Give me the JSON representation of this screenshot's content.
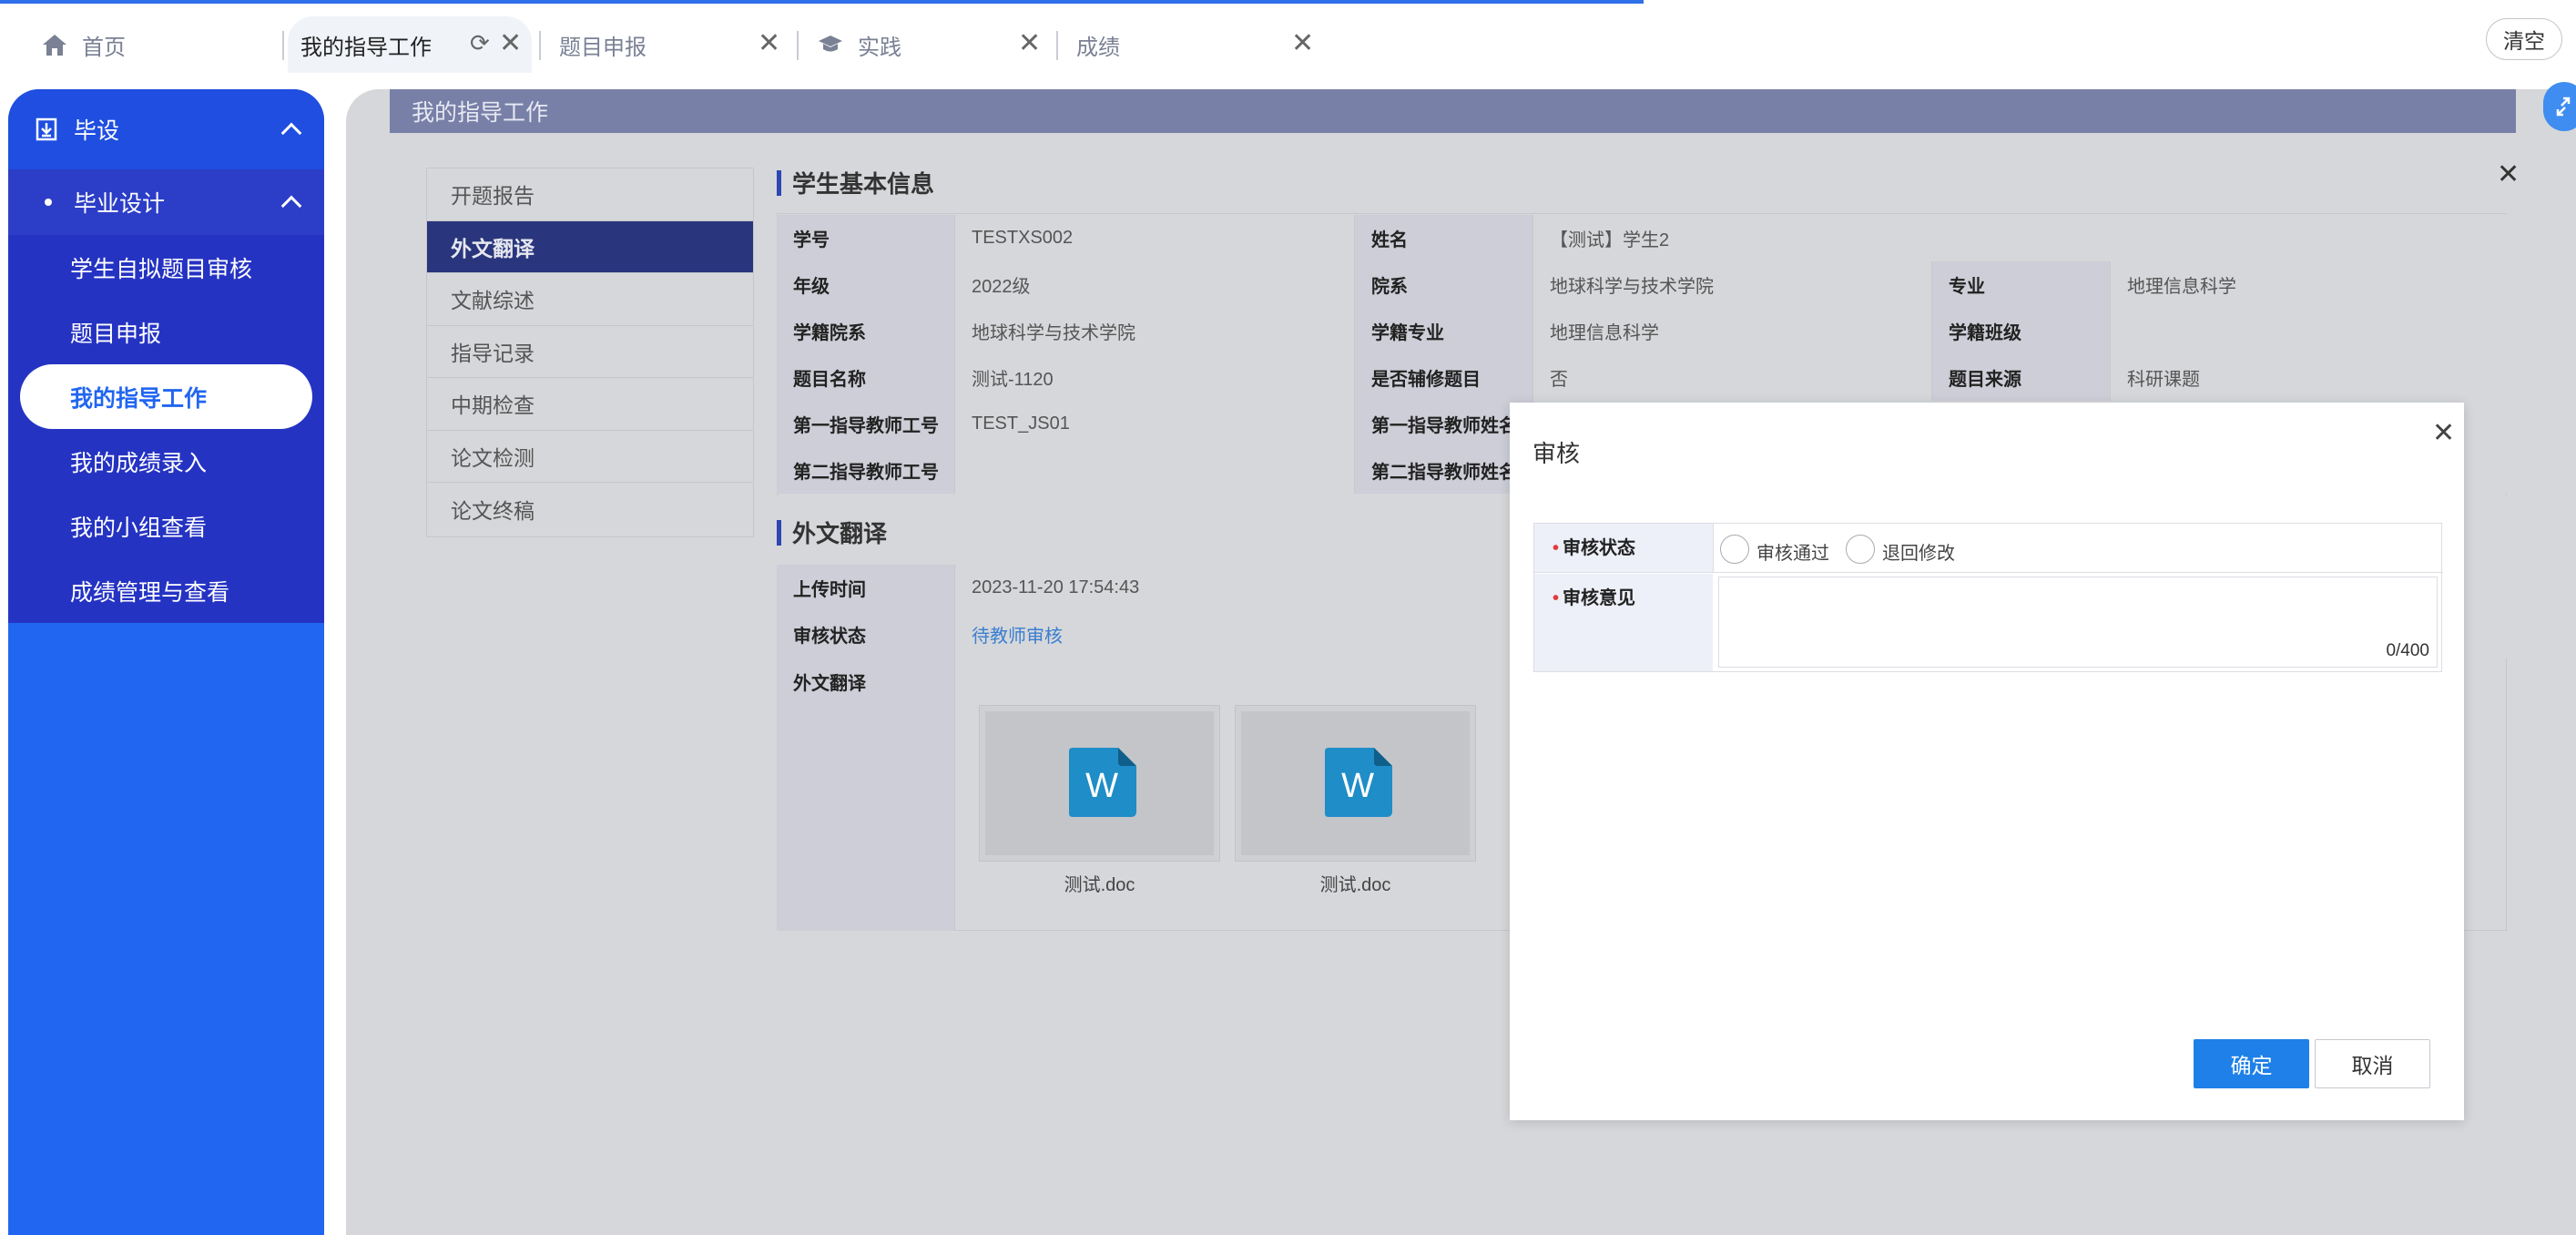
{
  "tabs": [
    {
      "label": "首页"
    },
    {
      "label": "我的指导工作"
    },
    {
      "label": "题目申报"
    },
    {
      "label": "实践"
    },
    {
      "label": "成绩"
    }
  ],
  "clear_label": "清空",
  "sidebar": {
    "top": {
      "label": "毕设"
    },
    "sub": {
      "label": "毕业设计"
    },
    "items": [
      {
        "label": "学生自拟题目审核"
      },
      {
        "label": "题目申报"
      },
      {
        "label": "我的指导工作"
      },
      {
        "label": "我的成绩录入"
      },
      {
        "label": "我的小组查看"
      },
      {
        "label": "成绩管理与查看"
      }
    ]
  },
  "page": {
    "title": "我的指导工作"
  },
  "left_nav": [
    {
      "label": "开题报告"
    },
    {
      "label": "外文翻译"
    },
    {
      "label": "文献综述"
    },
    {
      "label": "指导记录"
    },
    {
      "label": "中期检查"
    },
    {
      "label": "论文检测"
    },
    {
      "label": "论文终稿"
    }
  ],
  "student_info": {
    "heading": "学生基本信息",
    "r0": {
      "l1": "学号",
      "v1": "TESTXS002",
      "l2": "姓名",
      "v2": "【测试】学生2"
    },
    "r1": {
      "l1": "年级",
      "v1": "2022级",
      "l2": "院系",
      "v2": "地球科学与技术学院",
      "l3": "专业",
      "v3": "地理信息科学"
    },
    "r2": {
      "l1": "学籍院系",
      "v1": "地球科学与技术学院",
      "l2": "学籍专业",
      "v2": "地理信息科学",
      "l3": "学籍班级",
      "v3": ""
    },
    "r3": {
      "l1": "题目名称",
      "v1": "测试-1120",
      "l2": "是否辅修题目",
      "v2": "否",
      "l3": "题目来源",
      "v3": "科研课题"
    },
    "r4": {
      "l1": "第一指导教师工号",
      "v1": "TEST_JS01",
      "l2": "第一指导教师姓名"
    },
    "r5": {
      "l1": "第二指导教师工号",
      "v1": "",
      "l2": "第二指导教师姓名"
    }
  },
  "translation": {
    "heading": "外文翻译",
    "upload_time_label": "上传时间",
    "upload_time": "2023-11-20 17:54:43",
    "status_label": "审核状态",
    "status": "待教师审核",
    "files_label": "外文翻译",
    "files": [
      {
        "name": "测试.doc",
        "icon_letter": "W"
      },
      {
        "name": "测试.doc",
        "icon_letter": "W"
      }
    ]
  },
  "modal": {
    "title": "审核",
    "status_label": "审核状态",
    "options": [
      "审核通过",
      "退回修改"
    ],
    "comment_label": "审核意见",
    "comment_value": "",
    "counter": "0/400",
    "ok_label": "确定",
    "cancel_label": "取消"
  },
  "colors": {
    "accent": "#2166f0",
    "primary_button": "#1e80e8",
    "active_nav": "#29367d",
    "required_mark": "#e13c3c",
    "status_link": "#3a7ed0"
  }
}
